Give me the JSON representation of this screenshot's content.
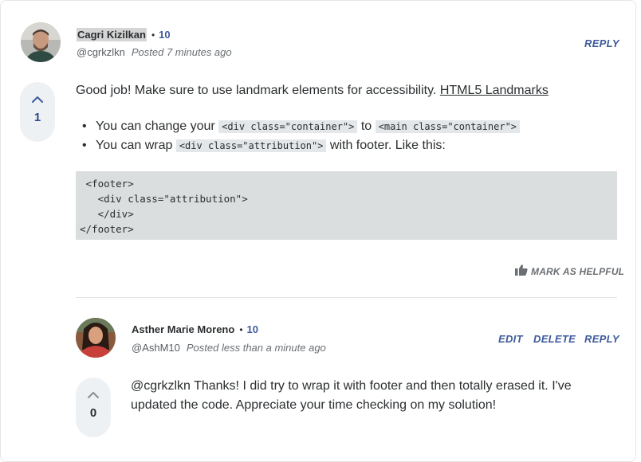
{
  "comment": {
    "author": "Cagri Kizilkan",
    "reputation": "10",
    "handle": "@cgrkzlkn",
    "posted": "Posted 7 minutes ago",
    "reply_label": "REPLY",
    "votes": "1",
    "intro_text": "Good job! Make sure to use landmark elements for accessibility.",
    "link_text": "HTML5 Landmarks",
    "bullets": [
      {
        "before": "You can change your",
        "code1": "<div class=\"container\">",
        "middle": "to",
        "code2": "<main class=\"container\">"
      },
      {
        "before": "You can wrap",
        "code1": "<div class=\"attribution\">",
        "after": "with footer. Like this:"
      }
    ],
    "code_block": " <footer>\n   <div class=\"attribution\">\n   </div>\n</footer>",
    "helpful_label": "MARK AS HELPFUL"
  },
  "reply": {
    "author": "Asther Marie Moreno",
    "reputation": "10",
    "handle": "@AshM10",
    "posted": "Posted less than a minute ago",
    "edit_label": "EDIT",
    "delete_label": "DELETE",
    "reply_label": "REPLY",
    "votes": "0",
    "text": "@cgrkzlkn Thanks! I did try to wrap it with footer and then totally erased it. I've updated the code. Appreciate your time checking on my solution!"
  }
}
